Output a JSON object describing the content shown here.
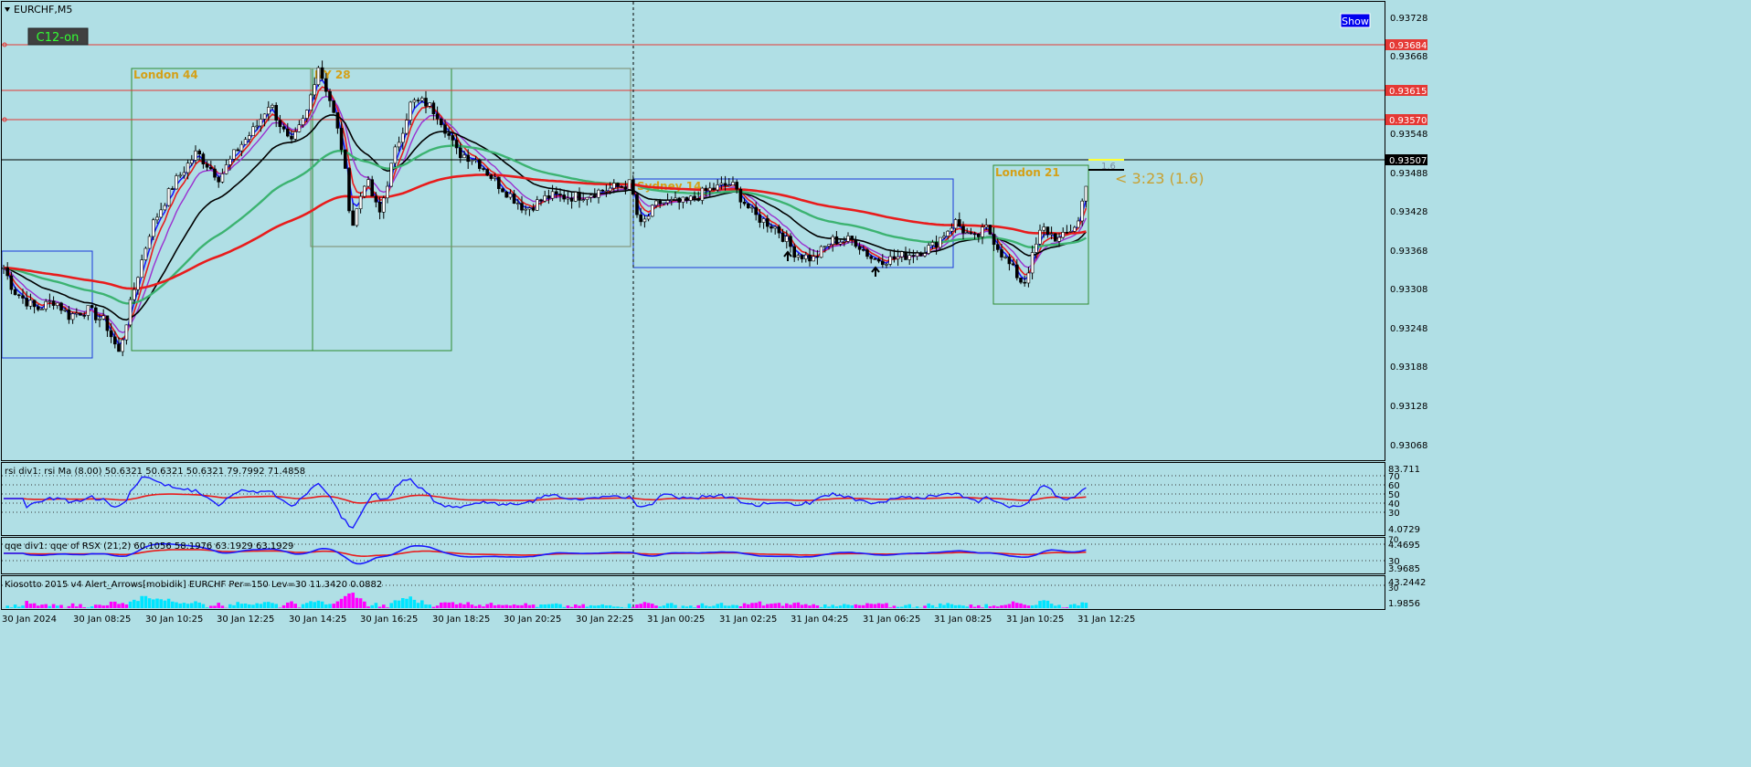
{
  "window": {
    "symbol_title": "EURCHF,M5",
    "c12_button": "C12-on",
    "show_button": "Show",
    "timer_label": "< 3:23 (1.6)",
    "spread_label": "1.6"
  },
  "colors": {
    "background": "#b0dfe5",
    "bull_body": "#ffffff",
    "bear_body": "#000000",
    "hline": "#e53935",
    "ma_fast": "#1a1aff",
    "ma_red": "#e81c1c",
    "ma_purple": "#9b30d0",
    "ma_black": "#000000",
    "ma_green": "#3cb371",
    "ma_slow_red": "#e81c1c",
    "session_london": "#2e8b2e",
    "session_ny": "#7a8a6a",
    "session_sydney": "#1a3adb",
    "session_label": "#d4a017",
    "hist_magenta": "#ff00ff",
    "hist_cyan": "#00e5ff"
  },
  "price_axis": {
    "ticks": [
      "0.93728",
      "0.93668",
      "0.93548",
      "0.93488",
      "0.93428",
      "0.93368",
      "0.93308",
      "0.93248",
      "0.93188",
      "0.93128",
      "0.93068"
    ],
    "hline_labels": [
      "0.93684",
      "0.93615",
      "0.93570"
    ],
    "current_price": "0.93507"
  },
  "time_axis": {
    "labels": [
      "30 Jan 2024",
      "30 Jan 08:25",
      "30 Jan 10:25",
      "30 Jan 12:25",
      "30 Jan 14:25",
      "30 Jan 16:25",
      "30 Jan 18:25",
      "30 Jan 20:25",
      "30 Jan 22:25",
      "31 Jan 00:25",
      "31 Jan 02:25",
      "31 Jan 04:25",
      "31 Jan 06:25",
      "31 Jan 08:25",
      "31 Jan 10:25",
      "31 Jan 12:25"
    ]
  },
  "sessions": [
    {
      "label": "London 44",
      "type": "london"
    },
    {
      "label": "NY 28",
      "type": "ny"
    },
    {
      "label": "Sydney 14",
      "type": "sydney"
    },
    {
      "label": "London 21",
      "type": "london"
    }
  ],
  "sub1": {
    "title": "rsi div1: rsi Ma (8.00) 50.6321 50.6321 50.6321 79.7992 71.4858",
    "ticks": [
      "83.711",
      "70",
      "60",
      "50",
      "40",
      "30",
      "4.0729"
    ]
  },
  "sub2": {
    "title": "qqe div1: qqe of RSX (21,2) 60.1056 58.1976 63.1929 63.1929",
    "ticks": [
      "4.4695",
      "70",
      "30",
      "3.9685"
    ]
  },
  "sub3": {
    "title": "Kiosotto 2015 v4 Alert_Arrows[mobidik] EURCHF Per=150 Lev=30 11.3420 0.0882",
    "ticks": [
      "43.2442",
      "30",
      "1.9856"
    ]
  },
  "chart_data": {
    "type": "candlestick",
    "symbol": "EURCHF",
    "timeframe": "M5",
    "price_range": [
      0.9303,
      0.9376
    ],
    "horizontal_levels": [
      0.93684,
      0.93615,
      0.9357
    ],
    "current_price": 0.93507,
    "price_anchors": [
      [
        0,
        0.9335
      ],
      [
        15,
        0.933
      ],
      [
        40,
        0.9327
      ],
      [
        60,
        0.93285
      ],
      [
        75,
        0.9326
      ],
      [
        95,
        0.9327
      ],
      [
        115,
        0.9325
      ],
      [
        130,
        0.932
      ],
      [
        148,
        0.9331
      ],
      [
        165,
        0.934
      ],
      [
        190,
        0.9347
      ],
      [
        215,
        0.9352
      ],
      [
        240,
        0.9348
      ],
      [
        262,
        0.9353
      ],
      [
        280,
        0.9356
      ],
      [
        295,
        0.936
      ],
      [
        318,
        0.9353
      ],
      [
        335,
        0.9358
      ],
      [
        348,
        0.9366
      ],
      [
        362,
        0.936
      ],
      [
        375,
        0.9352
      ],
      [
        385,
        0.934
      ],
      [
        400,
        0.9348
      ],
      [
        415,
        0.9342
      ],
      [
        432,
        0.9352
      ],
      [
        450,
        0.936
      ],
      [
        465,
        0.936
      ],
      [
        480,
        0.9358
      ],
      [
        500,
        0.9352
      ],
      [
        520,
        0.9351
      ],
      [
        545,
        0.9347
      ],
      [
        575,
        0.9343
      ],
      [
        600,
        0.9345
      ],
      [
        630,
        0.9345
      ],
      [
        660,
        0.9346
      ],
      [
        690,
        0.9347
      ],
      [
        700,
        0.934
      ],
      [
        720,
        0.9344
      ],
      [
        750,
        0.9344
      ],
      [
        775,
        0.9346
      ],
      [
        800,
        0.9347
      ],
      [
        825,
        0.9342
      ],
      [
        850,
        0.934
      ],
      [
        870,
        0.9336
      ],
      [
        890,
        0.9335
      ],
      [
        910,
        0.9338
      ],
      [
        935,
        0.9338
      ],
      [
        955,
        0.9335
      ],
      [
        975,
        0.9335
      ],
      [
        1000,
        0.9336
      ],
      [
        1020,
        0.9337
      ],
      [
        1045,
        0.9341
      ],
      [
        1065,
        0.9338
      ],
      [
        1080,
        0.934
      ],
      [
        1100,
        0.9335
      ],
      [
        1120,
        0.9331
      ],
      [
        1140,
        0.934
      ],
      [
        1160,
        0.9338
      ],
      [
        1180,
        0.9341
      ],
      [
        1192,
        0.935
      ]
    ]
  }
}
